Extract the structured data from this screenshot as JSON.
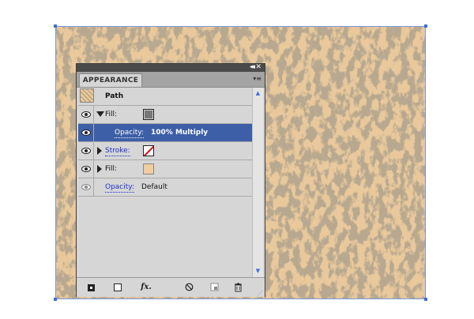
{
  "panel": {
    "tab_label": "APPEARANCE",
    "title_controls": {
      "collapse": "◂◂",
      "close": "✕"
    },
    "menu": "▾≡",
    "object_label": "Path",
    "rows": [
      {
        "label": "Fill:",
        "swatch_color": "#777777"
      },
      {
        "label": "Opacity:",
        "value": "100% Multiply"
      },
      {
        "label": "Stroke:",
        "swatch": "none"
      },
      {
        "label": "Fill:",
        "swatch_color": "#f0cc9e"
      },
      {
        "label": "Opacity:",
        "value": "Default"
      }
    ],
    "footer_icons": [
      "new-stroke-icon",
      "new-fill-icon",
      "fx-icon",
      "clear-appearance-icon",
      "duplicate-item-icon",
      "delete-item-icon"
    ],
    "fx_label": "fx.",
    "scroll_up": "▲",
    "scroll_down": "▼"
  },
  "colors": {
    "texture_light": "#e9c99c",
    "texture_dark": "#7a6446",
    "selection": "#3d5fa8",
    "link": "#1f2fc7"
  }
}
